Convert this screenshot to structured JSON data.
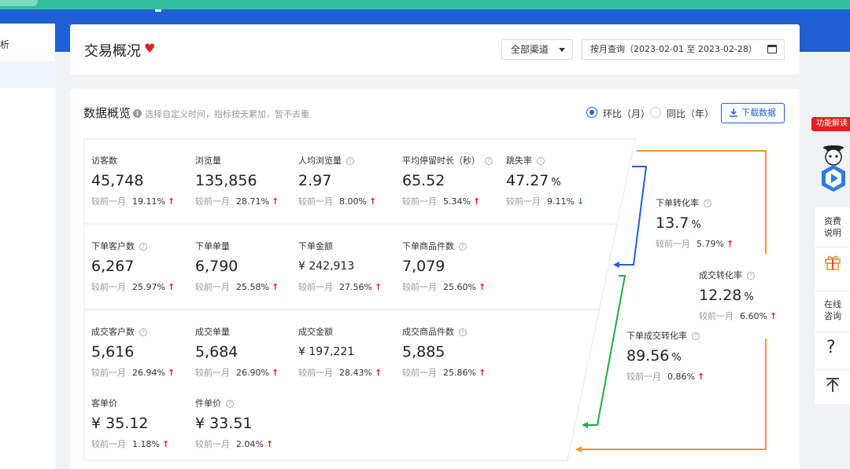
{
  "header": {
    "title": "交易概况",
    "channel_select": "全部渠道",
    "date_range": "按月查询（2023-02-01 至 2023-02-28）"
  },
  "overview": {
    "title": "数据概览",
    "hint": "选择自定义时间，指标按天累加，暂不去重",
    "radio_mom": "环比（月）",
    "radio_yoy": "同比（年）",
    "download_label": "下载数据",
    "compare_label": "较前一月"
  },
  "metrics": {
    "visitors": {
      "label": "访客数",
      "value": "45,748",
      "pct": "19.11%",
      "dir": "up"
    },
    "pageviews": {
      "label": "浏览量",
      "value": "135,856",
      "pct": "28.71%",
      "dir": "up"
    },
    "avg_views": {
      "label": "人均浏览量",
      "value": "2.97",
      "pct": "8.00%",
      "dir": "up"
    },
    "avg_stay": {
      "label": "平均停留时长（秒）",
      "value": "65.52",
      "pct": "5.34%",
      "dir": "up"
    },
    "bounce": {
      "label": "跳失率",
      "value": "47.27",
      "unit": "%",
      "pct": "9.11%",
      "dir": "down"
    },
    "order_customers": {
      "label": "下单客户数",
      "value": "6,267",
      "pct": "25.97%",
      "dir": "up"
    },
    "orders": {
      "label": "下单单量",
      "value": "6,790",
      "pct": "25.58%",
      "dir": "up"
    },
    "order_amount": {
      "label": "下单金额",
      "value": "¥ 242,913",
      "pct": "27.56%",
      "dir": "up"
    },
    "order_items": {
      "label": "下单商品件数",
      "value": "7,079",
      "pct": "25.60%",
      "dir": "up"
    },
    "deal_customers": {
      "label": "成交客户数",
      "value": "5,616",
      "pct": "26.94%",
      "dir": "up"
    },
    "deals": {
      "label": "成交单量",
      "value": "5,684",
      "pct": "26.90%",
      "dir": "up"
    },
    "deal_amount": {
      "label": "成交金额",
      "value": "¥ 197,221",
      "pct": "28.43%",
      "dir": "up"
    },
    "deal_items": {
      "label": "成交商品件数",
      "value": "5,885",
      "pct": "25.86%",
      "dir": "up"
    },
    "avg_order_price": {
      "label": "客单价",
      "value": "¥ 35.12",
      "pct": "1.18%",
      "dir": "up"
    },
    "avg_item_price": {
      "label": "件单价",
      "value": "¥ 33.51",
      "pct": "2.04%",
      "dir": "up"
    }
  },
  "conversions": {
    "order_rate": {
      "label": "下单转化率",
      "value": "13.7",
      "unit": "%",
      "pct": "5.79%",
      "dir": "up"
    },
    "deal_rate": {
      "label": "成交转化率",
      "value": "12.28",
      "unit": "%",
      "pct": "6.60%",
      "dir": "up"
    },
    "order_deal_rate": {
      "label": "下单成交转化率",
      "value": "89.56",
      "unit": "%",
      "pct": "0.86%",
      "dir": "up"
    }
  },
  "side": {
    "feature_badge": "功能解读",
    "doc_label": "资费说明",
    "consult_label": "在线咨询",
    "help_label": "?"
  },
  "left_nav": {
    "item0": "析"
  },
  "colors": {
    "blue_bar": "#1e5fd6",
    "green_bar": "#2fbf9a",
    "up": "#e02020",
    "down": "#22aa44",
    "funnel_blue": "#1e5fd6",
    "funnel_green": "#22aa44",
    "funnel_orange": "#e8963c"
  }
}
